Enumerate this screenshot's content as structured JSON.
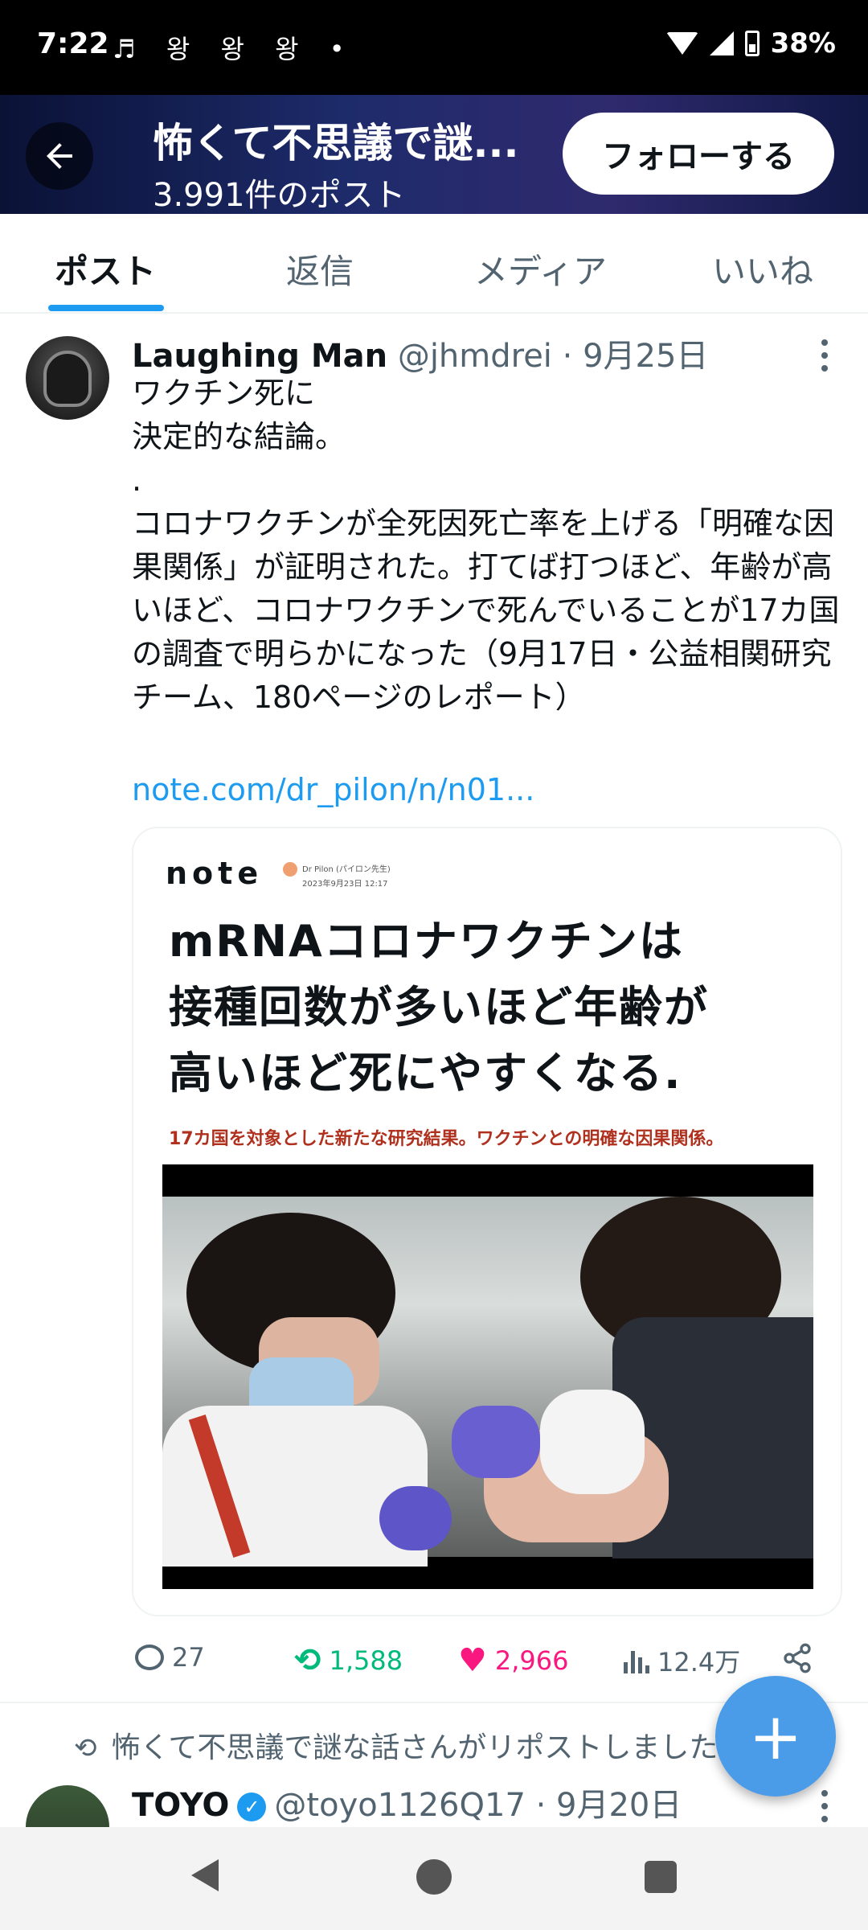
{
  "status_bar": {
    "time": "7:22",
    "notification_icons": "♬ 왕 왕 왕 •",
    "battery": "38%"
  },
  "header": {
    "title": "怖くて不思議で謎...",
    "post_count": "3.991件のポスト",
    "follow_label": "フォローする"
  },
  "tabs": [
    {
      "label": "ポスト",
      "active": true
    },
    {
      "label": "返信",
      "active": false
    },
    {
      "label": "メディア",
      "active": false
    },
    {
      "label": "いいね",
      "active": false
    }
  ],
  "post": {
    "author": "Laughing Man",
    "handle": "@jhmdrei",
    "date": "· 9月25日",
    "text": "ワクチン死に\n決定的な結論。\n.\nコロナワクチンが全死因死亡率を上げる「明確な因果関係」が証明された。打てば打つほど、年齢が高いほど、コロナワクチンで死んでいることが17カ国の調査で明らかになった（9月17日・公益相関研究チーム、180ページのレポート）",
    "link": "note.com/dr_pilon/n/n01...",
    "card": {
      "logo": "note",
      "author": "Dr Pilon (パイロン先生)",
      "author_date": "2023年9月23日 12:17",
      "headline": "mRNAコロナワクチンは\n接種回数が多いほど年齢が\n高いほど死にやすくなる.",
      "subheadline": "17カ国を対象とした新たな研究結果。ワクチンとの明確な因果関係。"
    },
    "stats": {
      "replies": "27",
      "reposts": "1,588",
      "likes": "2,966",
      "views": "12.4万"
    }
  },
  "next_post": {
    "repost_note": "怖くて不思議で謎な話さんがリポストしました",
    "author": "TOYO",
    "handle": "@toyo1126Q17",
    "date": "· 9月20日"
  },
  "colors": {
    "accent": "#1d9bf0",
    "retweet": "#00ba7c",
    "like": "#f91880",
    "fab": "#4a9be8"
  }
}
